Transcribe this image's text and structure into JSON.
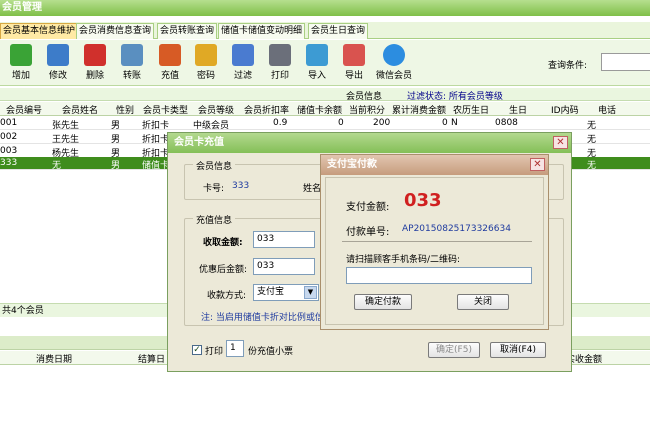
{
  "app": {
    "title": "会员管理"
  },
  "tabs": [
    "会员基本信息维护",
    "会员消费信息查询",
    "会员转账查询",
    "储值卡储值变动明细",
    "会员生日查询"
  ],
  "toolbar": {
    "buttons": [
      {
        "label": "增加",
        "icon": "add-icon",
        "color": "#3aa336"
      },
      {
        "label": "修改",
        "icon": "edit-icon",
        "color": "#3d7cc9"
      },
      {
        "label": "删除",
        "icon": "delete-icon",
        "color": "#d0302c"
      },
      {
        "label": "转账",
        "icon": "transfer-icon",
        "color": "#5a8fc0"
      },
      {
        "label": "充值",
        "icon": "recharge-icon",
        "color": "#d75b25"
      },
      {
        "label": "密码",
        "icon": "key-icon",
        "color": "#e0a925"
      },
      {
        "label": "过滤",
        "icon": "filter-icon",
        "color": "#4a7bd0"
      },
      {
        "label": "打印",
        "icon": "print-icon",
        "color": "#6b6f7a"
      },
      {
        "label": "导入",
        "icon": "import-icon",
        "color": "#3d9bd3"
      },
      {
        "label": "导出",
        "icon": "export-icon",
        "color": "#d9534f"
      },
      {
        "label": "微信会员",
        "icon": "wechat-icon",
        "color": "#2c8de0"
      }
    ],
    "search_label": "查询条件:"
  },
  "grid": {
    "group_label": "会员信息",
    "filter_status": "过滤状态: 所有会员等级",
    "columns": [
      "会员编号",
      "会员姓名",
      "性别",
      "会员卡类型",
      "会员等级",
      "会员折扣率",
      "储值卡余额",
      "当前积分",
      "累计消费金额",
      "农历生日",
      "生日",
      "ID内码",
      "电话"
    ],
    "rows": [
      [
        "001",
        "张先生",
        "男",
        "折扣卡",
        "中级会员",
        "0.9",
        "0",
        "200",
        "0",
        "N",
        "0808",
        "",
        "无"
      ],
      [
        "002",
        "王先生",
        "男",
        "折扣卡",
        "",
        "",
        "",
        "",
        "",
        "",
        "",
        "",
        "无"
      ],
      [
        "003",
        "杨先生",
        "男",
        "折扣卡",
        "",
        "",
        "",
        "",
        "",
        "",
        "",
        "",
        "无"
      ],
      [
        "333",
        "无",
        "男",
        "储值卡",
        "",
        "",
        "",
        "",
        "",
        "",
        "",
        "",
        "无"
      ]
    ],
    "footer": "共4个会员"
  },
  "lower_grid": {
    "columns": [
      "消费日期",
      "结算日",
      "实收金额"
    ]
  },
  "recharge": {
    "title": "会员卡充值",
    "member_info_legend": "会员信息",
    "card_no_label": "卡号:",
    "card_no": "333",
    "name_label": "姓名",
    "recharge_legend": "充值信息",
    "amount_label": "收取金额:",
    "amount": "033",
    "discounted_label": "优惠后金额:",
    "discounted": "033",
    "pay_method_label": "收款方式:",
    "pay_method": "支付宝",
    "note": "注: 当启用储值卡折对比例或信",
    "print_label": "打印",
    "print_copies": "1",
    "print_suffix": "份充值小票",
    "confirm_label": "确定(F5)",
    "cancel_label": "取消(F4)"
  },
  "alipay": {
    "title": "支付宝付款",
    "amount_label": "支付金额:",
    "amount": "033",
    "order_label": "付款单号:",
    "order_no": "AP20150825173326634",
    "scan_label": "请扫描顾客手机条码/二维码:",
    "confirm_label": "确定付款",
    "close_label": "关闭"
  }
}
